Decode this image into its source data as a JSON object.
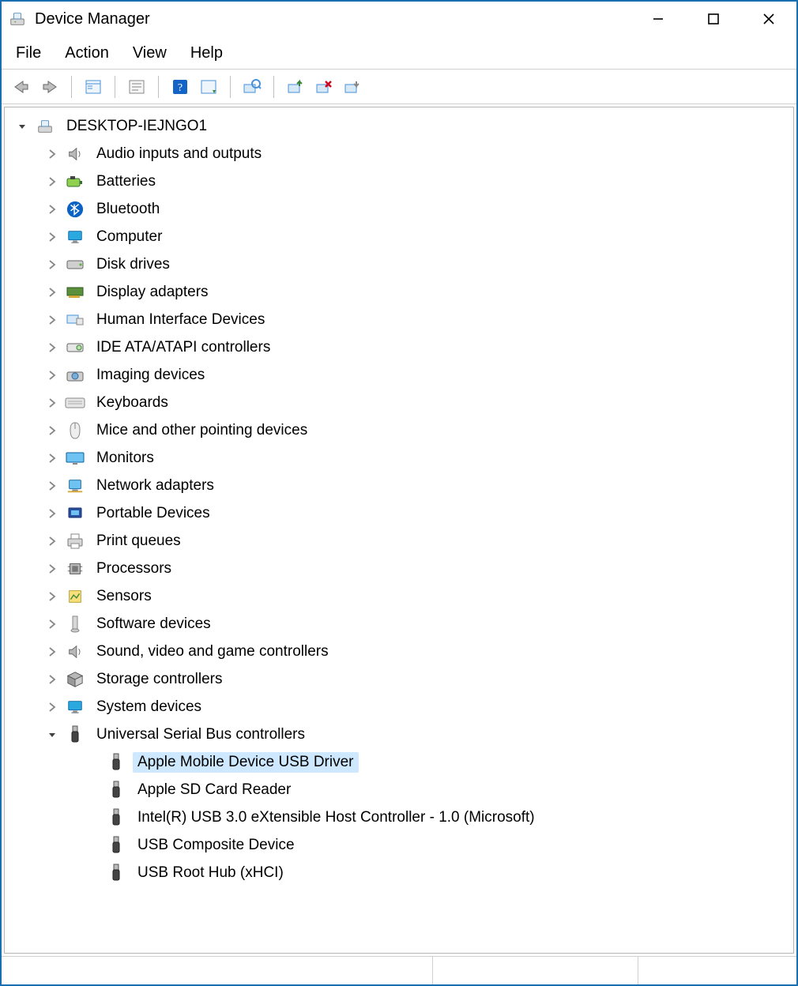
{
  "window": {
    "title": "Device Manager"
  },
  "menu": {
    "file": "File",
    "action": "Action",
    "view": "View",
    "help": "Help"
  },
  "tree": {
    "root": "DESKTOP-IEJNGO1",
    "categories": [
      {
        "label": "Audio inputs and outputs",
        "icon": "speaker"
      },
      {
        "label": "Batteries",
        "icon": "battery"
      },
      {
        "label": "Bluetooth",
        "icon": "bluetooth"
      },
      {
        "label": "Computer",
        "icon": "monitor"
      },
      {
        "label": "Disk drives",
        "icon": "disk"
      },
      {
        "label": "Display adapters",
        "icon": "display-adapter"
      },
      {
        "label": "Human Interface Devices",
        "icon": "hid"
      },
      {
        "label": "IDE ATA/ATAPI controllers",
        "icon": "ide"
      },
      {
        "label": "Imaging devices",
        "icon": "camera"
      },
      {
        "label": "Keyboards",
        "icon": "keyboard"
      },
      {
        "label": "Mice and other pointing devices",
        "icon": "mouse"
      },
      {
        "label": "Monitors",
        "icon": "monitor-wide"
      },
      {
        "label": "Network adapters",
        "icon": "network"
      },
      {
        "label": "Portable Devices",
        "icon": "portable"
      },
      {
        "label": "Print queues",
        "icon": "printer"
      },
      {
        "label": "Processors",
        "icon": "cpu"
      },
      {
        "label": "Sensors",
        "icon": "sensor"
      },
      {
        "label": "Software devices",
        "icon": "software"
      },
      {
        "label": "Sound, video and game controllers",
        "icon": "speaker"
      },
      {
        "label": "Storage controllers",
        "icon": "storage"
      },
      {
        "label": "System devices",
        "icon": "monitor"
      },
      {
        "label": "Universal Serial Bus controllers",
        "icon": "usb",
        "expanded": true
      }
    ],
    "usb_children": [
      {
        "label": "Apple Mobile Device USB Driver",
        "selected": true
      },
      {
        "label": "Apple SD Card Reader"
      },
      {
        "label": "Intel(R) USB 3.0 eXtensible Host Controller - 1.0 (Microsoft)"
      },
      {
        "label": "USB Composite Device"
      },
      {
        "label": "USB Root Hub (xHCI)"
      }
    ]
  }
}
